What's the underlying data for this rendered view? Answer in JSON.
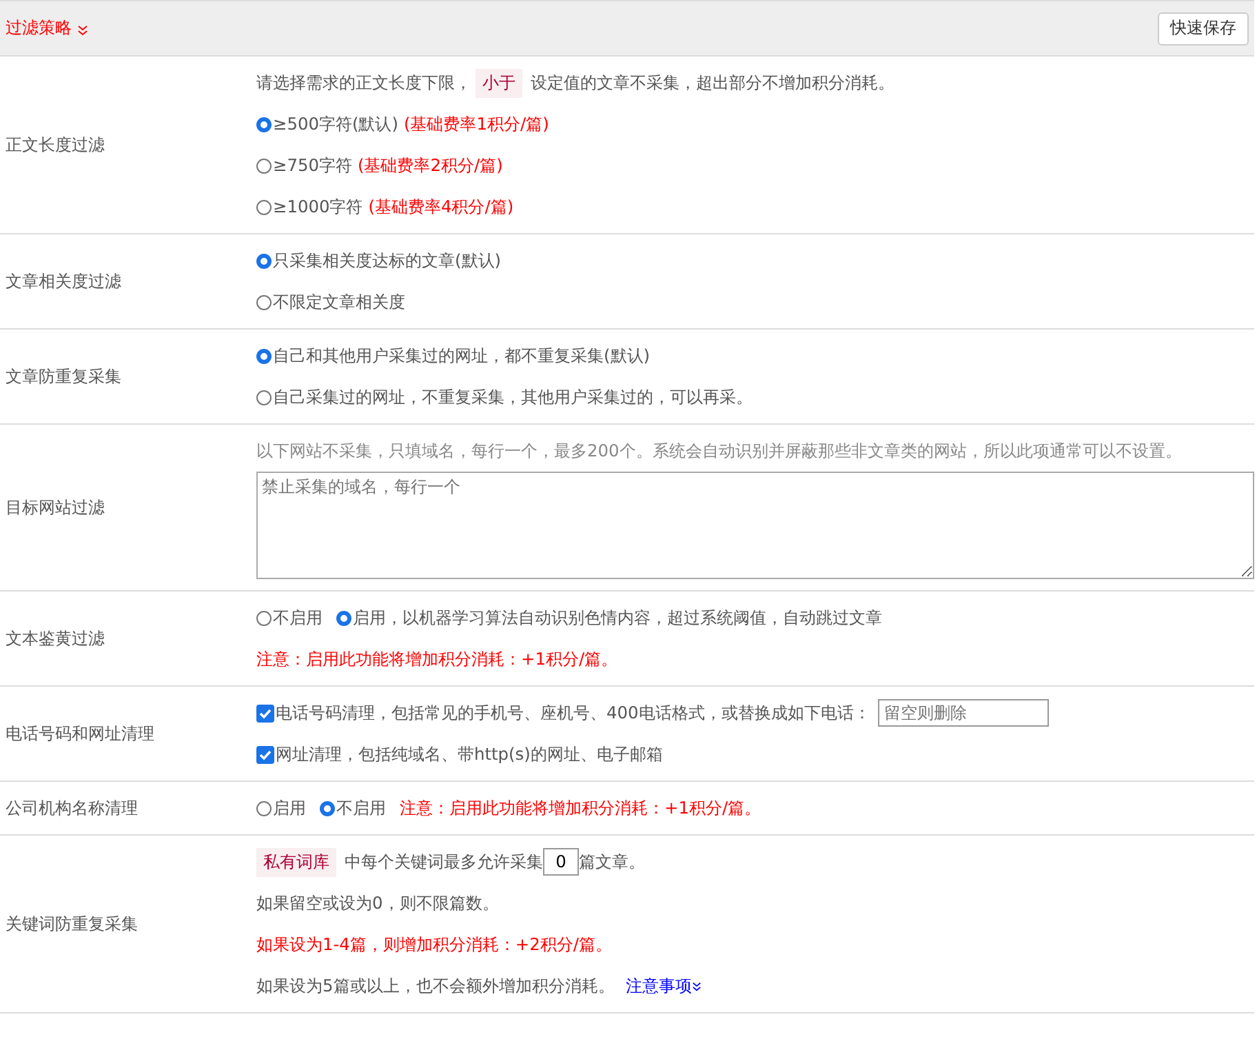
{
  "header": {
    "title": "过滤策略",
    "save_button": "快速保存"
  },
  "sections": [
    {
      "kind": "radio_list",
      "label": "正文长度过滤",
      "note": {
        "before": "请选择需求的正文长度下限，",
        "tag": "小于",
        "after": "设定值的文章不采集，超出部分不增加积分消耗。"
      },
      "options": [
        {
          "label": "≥500字符(默认)",
          "fee": "(基础费率1积分/篇)",
          "selected": true
        },
        {
          "label": "≥750字符",
          "fee": "(基础费率2积分/篇)",
          "selected": false
        },
        {
          "label": "≥1000字符",
          "fee": "(基础费率4积分/篇)",
          "selected": false
        }
      ]
    },
    {
      "kind": "radio_list",
      "label": "文章相关度过滤",
      "options": [
        {
          "label": "只采集相关度达标的文章(默认)",
          "selected": true
        },
        {
          "label": "不限定文章相关度",
          "selected": false
        }
      ]
    },
    {
      "kind": "radio_list",
      "label": "文章防重复采集",
      "options": [
        {
          "label": "自己和其他用户采集过的网址，都不重复采集(默认)",
          "selected": true
        },
        {
          "label": "自己采集过的网址，不重复采集，其他用户采集过的，可以再采。",
          "selected": false
        }
      ]
    },
    {
      "kind": "textarea",
      "label": "目标网站过滤",
      "note": "以下网站不采集，只填域名，每行一个，最多200个。系统会自动识别并屏蔽那些非文章类的网站，所以此项通常可以不设置。",
      "placeholder": "禁止采集的域名，每行一个"
    },
    {
      "kind": "radio_inline",
      "label": "文本鉴黄过滤",
      "options": [
        {
          "label": "不启用",
          "selected": false
        },
        {
          "label": "启用，以机器学习算法自动识别色情内容，超过系统阈值，自动跳过文章",
          "selected": true
        }
      ],
      "warning": "注意：启用此功能将增加积分消耗：+1积分/篇。"
    },
    {
      "kind": "checkbox_list",
      "label": "电话号码和网址清理",
      "items": [
        {
          "label": "电话号码清理，包括常见的手机号、座机号、400电话格式，或替换成如下电话：",
          "checked": true,
          "placeholder": "留空则删除"
        },
        {
          "label": "网址清理，包括纯域名、带http(s)的网址、电子邮箱",
          "checked": true
        }
      ]
    },
    {
      "kind": "radio_inline",
      "label": "公司机构名称清理",
      "options": [
        {
          "label": "启用",
          "selected": false
        },
        {
          "label": "不启用",
          "selected": true
        }
      ],
      "inline_warning": "注意：启用此功能将增加积分消耗：+1积分/篇。"
    },
    {
      "kind": "keyword_limit",
      "label": "关键词防重复采集",
      "tag": "私有词库",
      "before": "中每个关键词最多允许采集",
      "value": "0",
      "after": "篇文章。",
      "lines": [
        {
          "text": "如果留空或设为0，则不限篇数。",
          "warning": false
        },
        {
          "text": "如果设为1-4篇，则增加积分消耗：+2积分/篇。",
          "warning": true
        },
        {
          "text": "如果设为5篇或以上，也不会额外增加积分消耗。",
          "warning": false,
          "link": "注意事项"
        }
      ]
    }
  ]
}
